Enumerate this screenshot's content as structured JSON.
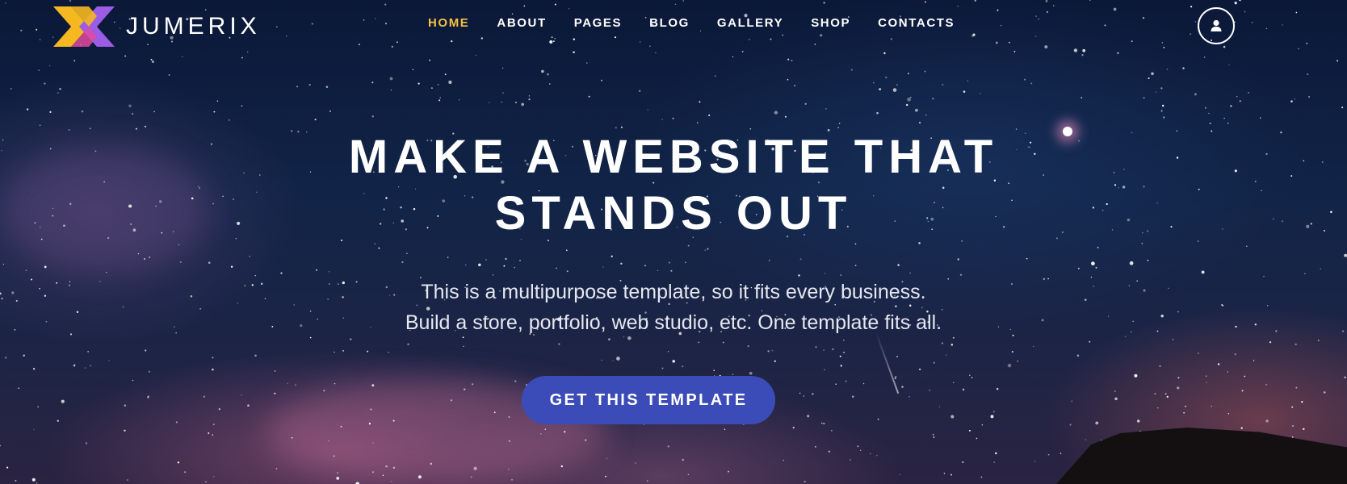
{
  "brand": {
    "name": "JUMERIX"
  },
  "nav": {
    "items": [
      {
        "label": "HOME",
        "active": true
      },
      {
        "label": "ABOUT",
        "active": false
      },
      {
        "label": "PAGES",
        "active": false
      },
      {
        "label": "BLOG",
        "active": false
      },
      {
        "label": "GALLERY",
        "active": false
      },
      {
        "label": "SHOP",
        "active": false
      },
      {
        "label": "CONTACTS",
        "active": false
      }
    ],
    "active_color": "#f5c242",
    "user_icon": "user-icon"
  },
  "hero": {
    "headline_line1": "MAKE A WEBSITE THAT",
    "headline_line2": "STANDS OUT",
    "sub_line1": "This is a multipurpose template, so it fits every business.",
    "sub_line2": "Build a store, portfolio, web studio, etc. One template fits all.",
    "cta_label": "GET THIS TEMPLATE",
    "cta_color": "#3b4cb8"
  }
}
